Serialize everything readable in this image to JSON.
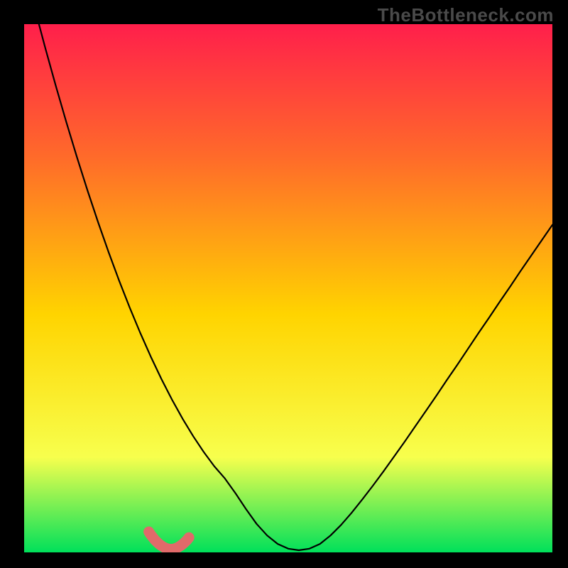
{
  "watermark": "TheBottleneck.com",
  "chart_data": {
    "type": "line",
    "title": "",
    "xlabel": "",
    "ylabel": "",
    "xlim": [
      0,
      100
    ],
    "ylim": [
      0,
      100
    ],
    "grid": false,
    "legend": false,
    "background_gradient_top": "#ff1f4b",
    "background_gradient_mid_upper": "#ff6a2a",
    "background_gradient_mid": "#ffd400",
    "background_gradient_lower": "#f7ff4d",
    "background_gradient_bottom": "#00e05a",
    "curve_color": "#000000",
    "highlight_color": "#e16a6a",
    "series": [
      {
        "name": "bottleneck_curve",
        "x": [
          0,
          2,
          4,
          6,
          8,
          10,
          12,
          14,
          16,
          18,
          20,
          22,
          24,
          26,
          28,
          30,
          32,
          34,
          36,
          38,
          40,
          42,
          44,
          46,
          48,
          50,
          52,
          54,
          56,
          58,
          60,
          62,
          64,
          66,
          68,
          70,
          72,
          74,
          76,
          78,
          80,
          82,
          84,
          86,
          88,
          90,
          92,
          94,
          96,
          98,
          100
        ],
        "y": [
          111,
          103,
          95.5,
          88.3,
          81.4,
          74.8,
          68.5,
          62.5,
          56.8,
          51.4,
          46.3,
          41.5,
          37,
          32.8,
          28.9,
          25.3,
          22,
          19,
          16.3,
          14,
          11.2,
          8.2,
          5.4,
          3.2,
          1.6,
          0.7,
          0.4,
          0.7,
          1.6,
          3.2,
          5.2,
          7.5,
          10,
          12.6,
          15.3,
          18.1,
          20.9,
          23.8,
          26.7,
          29.6,
          32.6,
          35.5,
          38.5,
          41.5,
          44.4,
          47.4,
          50.3,
          53.3,
          56.2,
          59.1,
          62
        ]
      }
    ],
    "highlight_segment": {
      "x": [
        23.6,
        24.0,
        24.4,
        24.8,
        25.2,
        25.6,
        26.0,
        26.4,
        26.8,
        27.2,
        27.6,
        28.0,
        28.4,
        28.8,
        29.2,
        29.6,
        30.0,
        30.4,
        30.8,
        31.2
      ],
      "y": [
        3.9,
        3.3,
        2.8,
        2.3,
        1.9,
        1.55,
        1.25,
        1.0,
        0.8,
        0.67,
        0.6,
        0.6,
        0.67,
        0.8,
        1.0,
        1.25,
        1.55,
        1.9,
        2.3,
        2.8
      ]
    }
  }
}
